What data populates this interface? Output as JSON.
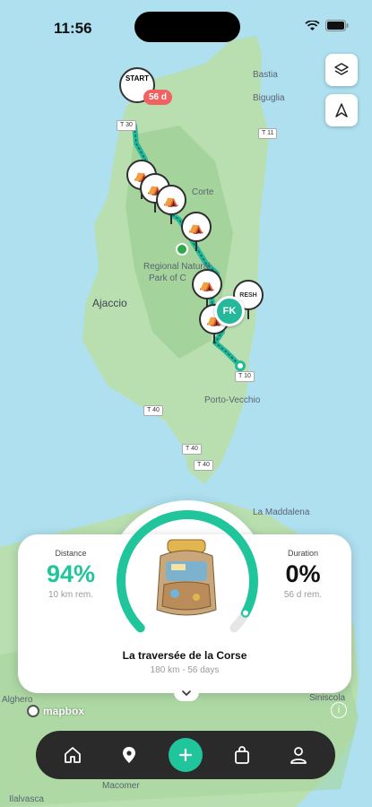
{
  "status": {
    "time": "11:56"
  },
  "map": {
    "labels": {
      "bastia": "Bastia",
      "biguglia": "Biguglia",
      "ajaccio": "Ajaccio",
      "corte": "Corte",
      "park1": "Regional Natural",
      "park2": "Park of C",
      "porto_vecchio": "Porto-Vecchio",
      "maddalena": "La Maddalena",
      "alghero": "Alghero",
      "siniscola": "Siniscola",
      "macomer": "Macomer",
      "ilalvasca": "Ilalvasca"
    },
    "roads": {
      "t30": "T 30",
      "t11": "T 11",
      "t10": "T 10",
      "t40a": "T 40",
      "t40b": "T 40",
      "t40c": "T 40"
    },
    "markers": {
      "start_label": "START",
      "days_badge": "56 d",
      "fk_label": "FK",
      "fresh_label": "RESH"
    },
    "attribution": "mapbox"
  },
  "controls": {
    "layers_icon": "layers-icon",
    "navigate_icon": "navigation-arrow-icon"
  },
  "stats": {
    "distance": {
      "label": "Distance",
      "value": "94%",
      "sub": "10 km rem."
    },
    "duration": {
      "label": "Duration",
      "value": "0%",
      "sub": "56 d rem."
    },
    "gauge_progress": 0.94,
    "accent": "#21c59b"
  },
  "trip": {
    "title": "La traversée de la Corse",
    "subtitle": "180 km - 56 days"
  },
  "nav": {
    "items": [
      "home-icon",
      "location-pin-icon",
      "add-icon",
      "shopping-bag-icon",
      "profile-icon"
    ]
  }
}
